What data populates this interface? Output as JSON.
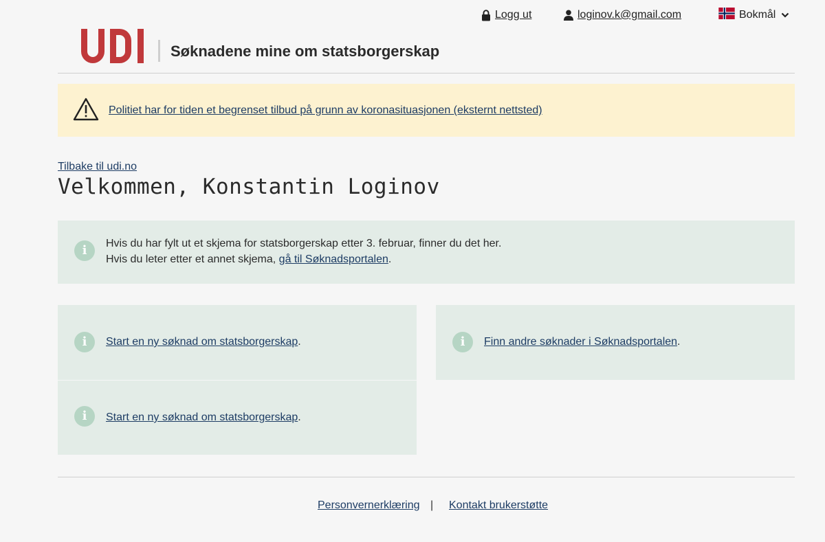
{
  "topbar": {
    "logout_label": "Logg ut",
    "user_email": "loginov.k@gmail.com",
    "language_label": "Bokmål"
  },
  "header": {
    "logo_text": "UDI",
    "title": "Søknadene mine om statsborgerskap"
  },
  "warning": {
    "text": "Politiet har for tiden et begrenset tilbud på grunn av koronasituasjonen (eksternt nettsted)"
  },
  "main": {
    "back_link": "Tilbake til udi.no",
    "welcome": "Velkommen, Konstantin Loginov"
  },
  "notice": {
    "line1": "Hvis du har fylt ut et skjema for statsborgerskap etter 3. februar, finner du det her.",
    "line2_prefix": "Hvis du leter etter et annet skjema, ",
    "line2_link": "gå til Søknadsportalen",
    "line2_suffix": "."
  },
  "cards": [
    {
      "link": "Start en ny søknad om statsborgerskap",
      "suffix": "."
    },
    {
      "link": "Start en ny søknad om statsborgerskap",
      "suffix": "."
    },
    {
      "link": "Finn andre søknader i Søknadsportalen",
      "suffix": "."
    }
  ],
  "footer": {
    "privacy": "Personvernerklæring",
    "separator": "|",
    "support": "Kontakt brukerstøtte"
  },
  "colors": {
    "brand_red": "#c0393b",
    "link": "#1d3c64",
    "warning_bg": "#fdf2d0",
    "info_bg": "#e3ece7",
    "info_icon": "#b6d5c4"
  },
  "icons": {
    "lock": "lock-icon",
    "user": "user-icon",
    "flag": "norway-flag-icon",
    "chevron": "chevron-down-icon",
    "warning": "warning-triangle-icon",
    "info": "info-icon"
  }
}
